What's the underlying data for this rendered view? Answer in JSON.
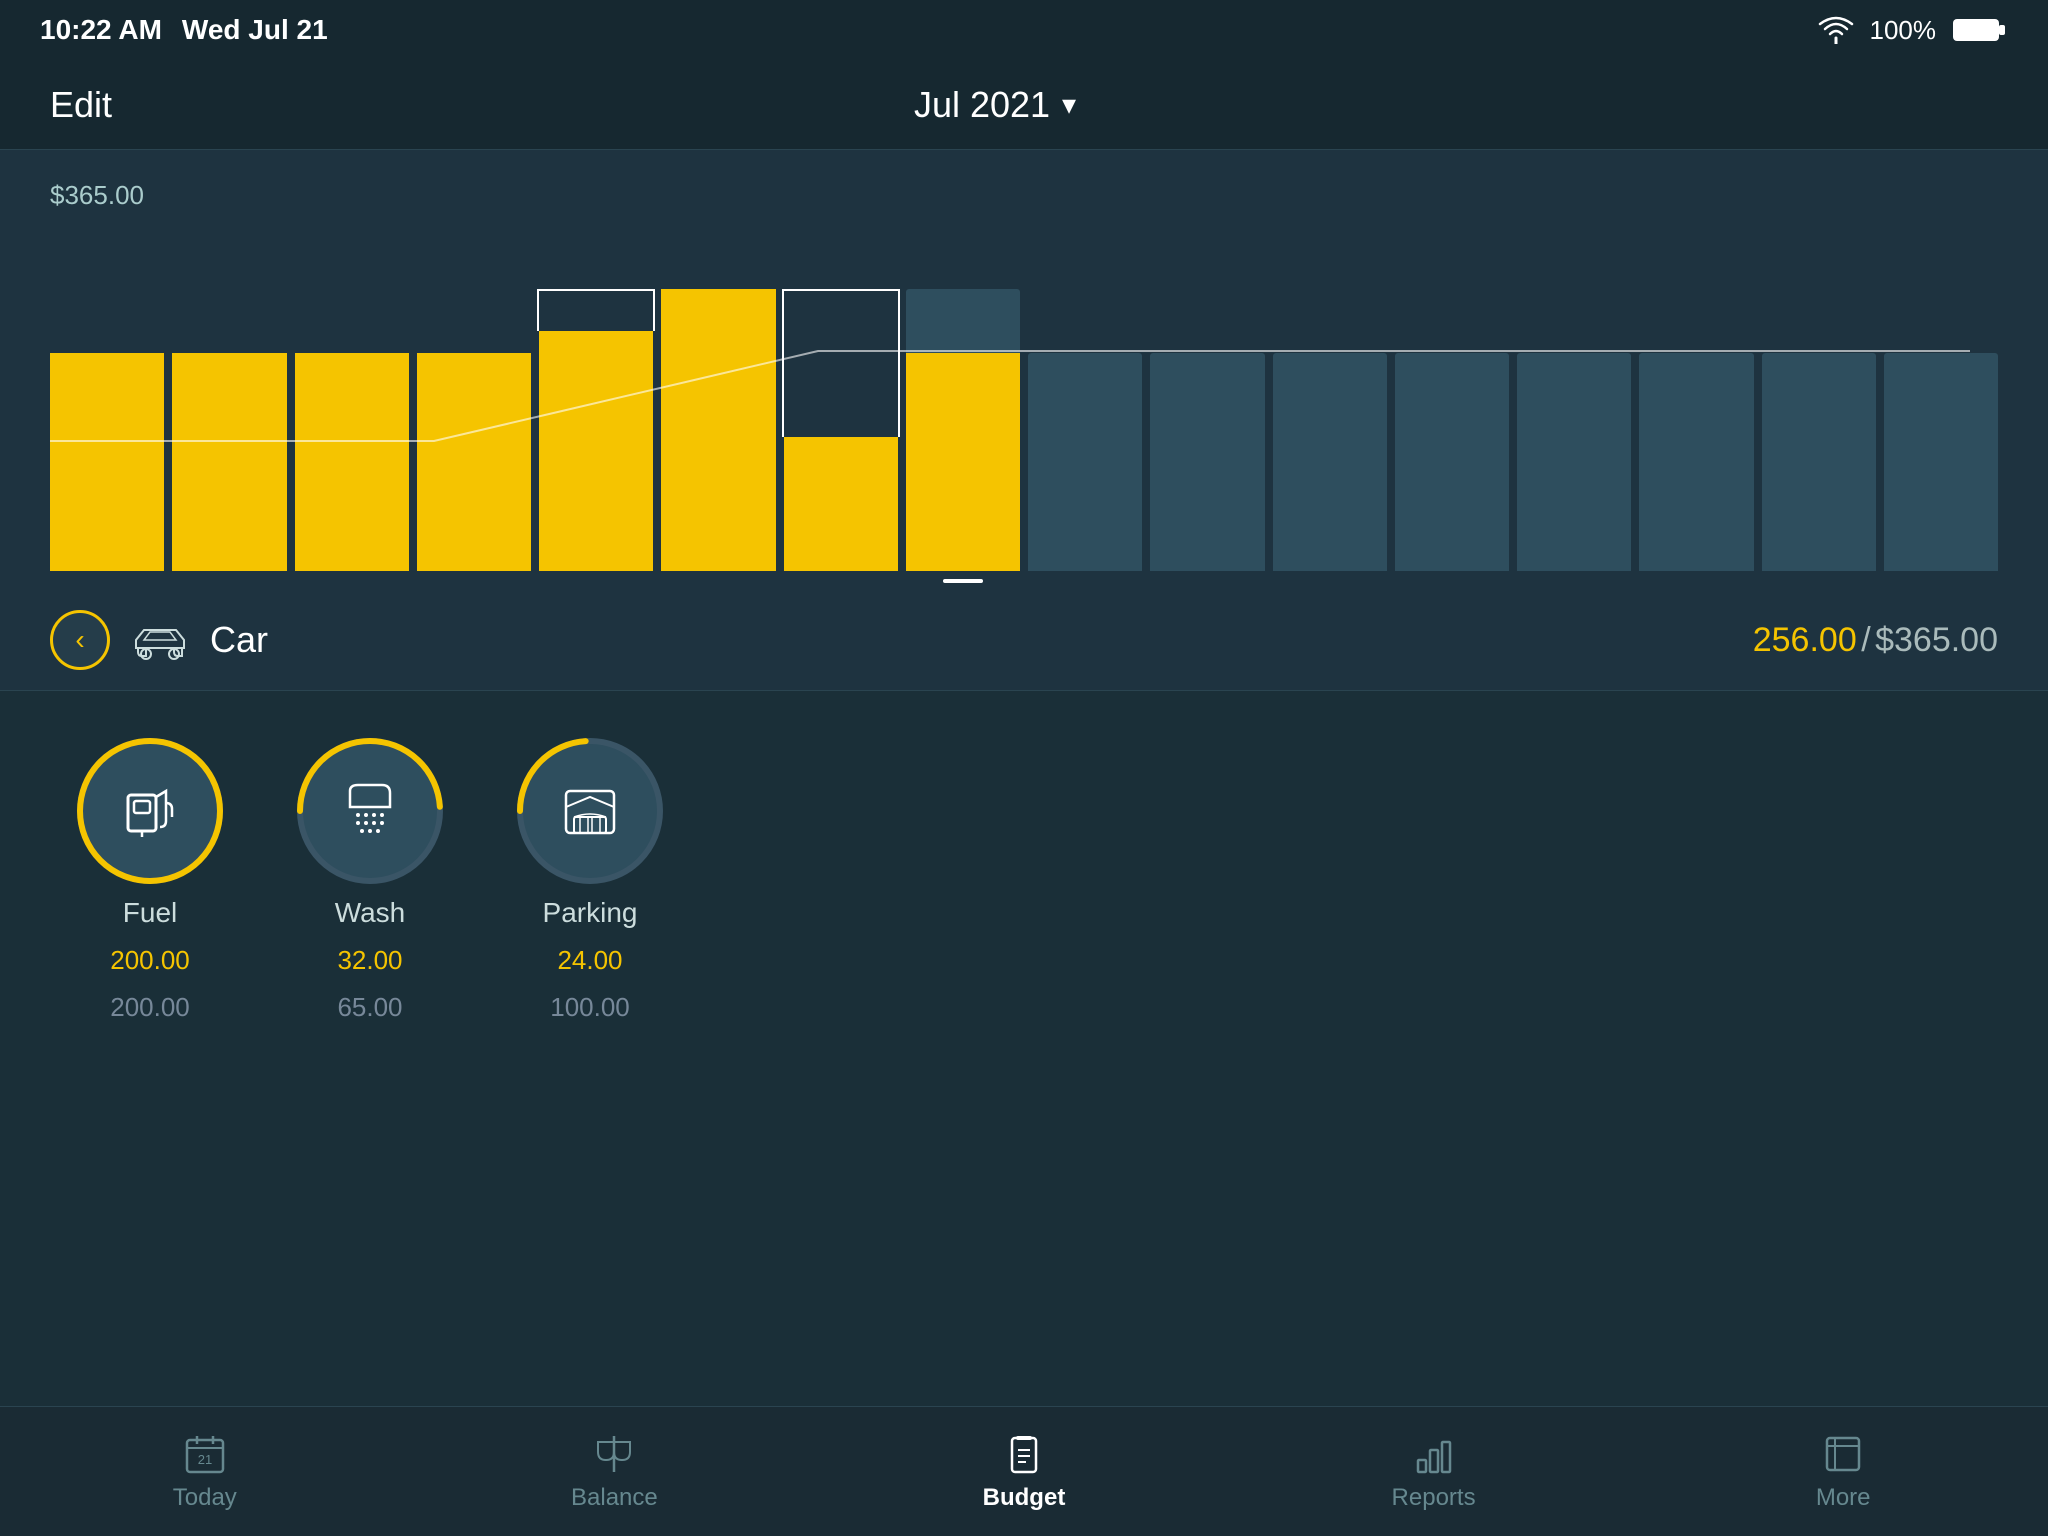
{
  "status": {
    "time": "10:22 AM",
    "date": "Wed Jul 21",
    "wifi": "100%",
    "battery": "100%"
  },
  "nav": {
    "edit_label": "Edit",
    "title": "Jul 2021",
    "chevron": "▾"
  },
  "chart": {
    "max_label": "$365.00",
    "bars": [
      {
        "height_pct": 68,
        "fill_pct": 68,
        "has_outline": false,
        "outline_height": 0
      },
      {
        "height_pct": 68,
        "fill_pct": 68,
        "has_outline": false,
        "outline_height": 0
      },
      {
        "height_pct": 68,
        "fill_pct": 68,
        "has_outline": false,
        "outline_height": 0
      },
      {
        "height_pct": 68,
        "fill_pct": 68,
        "has_outline": false,
        "outline_height": 0
      },
      {
        "height_pct": 75,
        "fill_pct": 75,
        "has_outline": true,
        "outline_height": 88
      },
      {
        "height_pct": 88,
        "fill_pct": 88,
        "has_outline": false,
        "outline_height": 0
      },
      {
        "height_pct": 42,
        "fill_pct": 42,
        "has_outline": true,
        "outline_height": 88
      },
      {
        "height_pct": 88,
        "fill_pct": 68,
        "has_outline": false,
        "selected": true,
        "outline_height": 0
      },
      {
        "height_pct": 68,
        "fill_pct": 0,
        "has_outline": false,
        "outline_height": 0
      },
      {
        "height_pct": 68,
        "fill_pct": 0,
        "has_outline": false,
        "outline_height": 0
      },
      {
        "height_pct": 68,
        "fill_pct": 0,
        "has_outline": false,
        "outline_height": 0
      },
      {
        "height_pct": 68,
        "fill_pct": 0,
        "has_outline": false,
        "outline_height": 0
      },
      {
        "height_pct": 68,
        "fill_pct": 0,
        "has_outline": false,
        "outline_height": 0
      },
      {
        "height_pct": 68,
        "fill_pct": 0,
        "has_outline": false,
        "outline_height": 0
      },
      {
        "height_pct": 68,
        "fill_pct": 0,
        "has_outline": false,
        "outline_height": 0
      },
      {
        "height_pct": 68,
        "fill_pct": 0,
        "has_outline": false,
        "outline_height": 0
      }
    ]
  },
  "category": {
    "name": "Car",
    "spent": "256.00",
    "budget": "$365.00",
    "back_label": "<"
  },
  "subcategories": [
    {
      "name": "Fuel",
      "icon": "⛽",
      "spent": "200.00",
      "budget": "200.00",
      "ring_color": "#f5c400",
      "ring_pct": 100
    },
    {
      "name": "Wash",
      "icon": "🚿",
      "spent": "32.00",
      "budget": "65.00",
      "ring_color": "#f5c400",
      "ring_pct": 49
    },
    {
      "name": "Parking",
      "icon": "🅿",
      "spent": "24.00",
      "budget": "100.00",
      "ring_color": "#f5c400",
      "ring_pct": 24
    }
  ],
  "tabs": [
    {
      "label": "Today",
      "icon": "📅",
      "active": false
    },
    {
      "label": "Balance",
      "icon": "⚖",
      "active": false
    },
    {
      "label": "Budget",
      "icon": "📱",
      "active": true
    },
    {
      "label": "Reports",
      "icon": "📊",
      "active": false
    },
    {
      "label": "More",
      "icon": "📋",
      "active": false
    }
  ]
}
